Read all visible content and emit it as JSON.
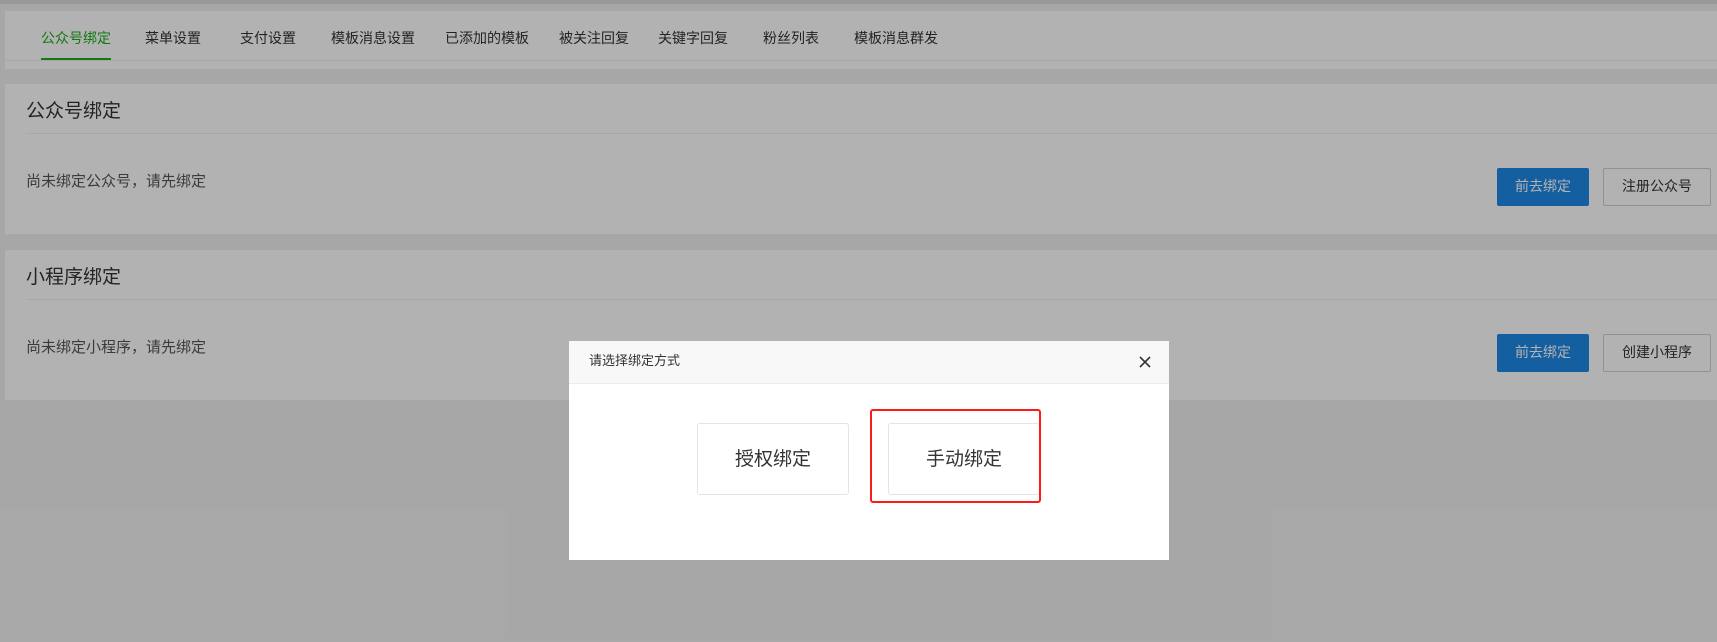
{
  "tabs": [
    {
      "label": "公众号绑定",
      "active": true
    },
    {
      "label": "菜单设置"
    },
    {
      "label": "支付设置"
    },
    {
      "label": "模板消息设置"
    },
    {
      "label": "已添加的模板"
    },
    {
      "label": "被关注回复"
    },
    {
      "label": "关键字回复"
    },
    {
      "label": "粉丝列表"
    },
    {
      "label": "模板消息群发"
    }
  ],
  "official_account": {
    "title": "公众号绑定",
    "message": "尚未绑定公众号，请先绑定",
    "primary_button": "前去绑定",
    "secondary_button": "注册公众号"
  },
  "mini_program": {
    "title": "小程序绑定",
    "message": "尚未绑定小程序，请先绑定",
    "primary_button": "前去绑定",
    "secondary_button": "创建小程序"
  },
  "modal": {
    "title": "请选择绑定方式",
    "close_icon": "close-icon",
    "options": [
      {
        "label": "授权绑定"
      },
      {
        "label": "手动绑定",
        "highlighted": true
      }
    ]
  },
  "colors": {
    "accent_green": "#1aad19",
    "primary_blue": "#1e88e5",
    "highlight_red": "#ff1a1a"
  }
}
